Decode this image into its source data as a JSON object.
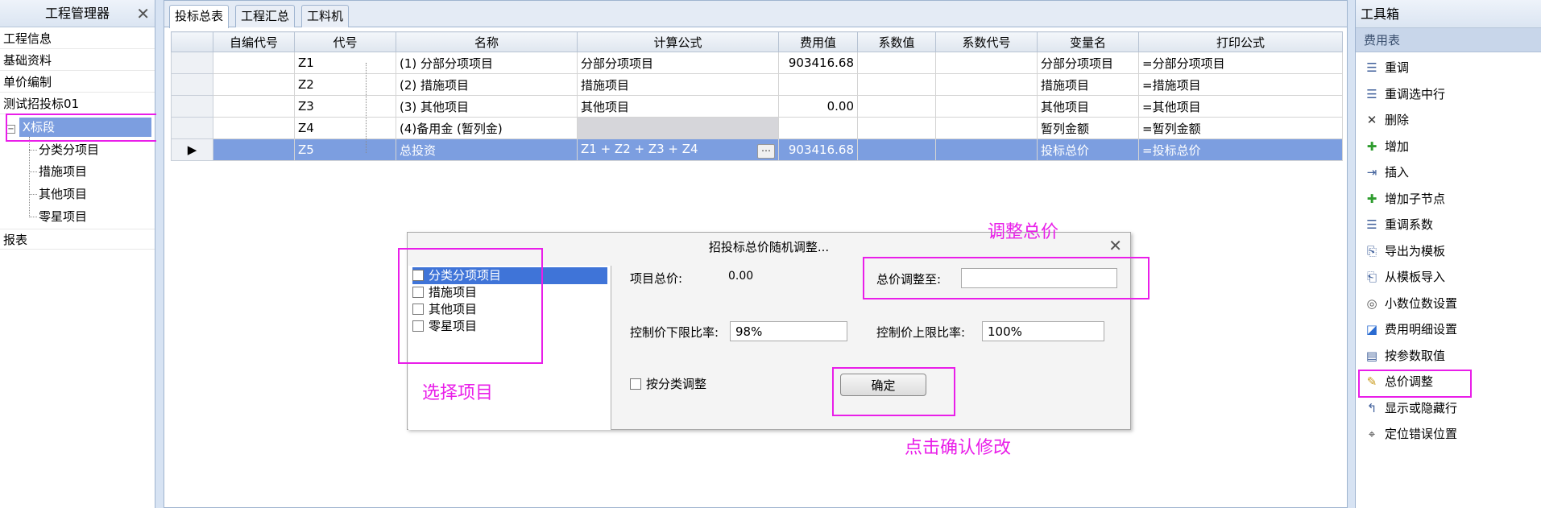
{
  "left_panel": {
    "title": "工程管理器",
    "items": [
      "工程信息",
      "基础资料",
      "单价编制",
      "测试招投标01"
    ],
    "section_node": "X标段",
    "children": [
      "分类分项目",
      "措施项目",
      "其他项目",
      "零星项目"
    ],
    "footer_item": "报表"
  },
  "tabs": [
    "投标总表",
    "工程汇总",
    "工料机"
  ],
  "grid": {
    "columns": [
      "自编代号",
      "代号",
      "名称",
      "计算公式",
      "费用值",
      "系数值",
      "系数代号",
      "变量名",
      "打印公式"
    ],
    "rows": [
      {
        "code": "Z1",
        "name": "(1) 分部分项项目",
        "formula": "分部分项项目",
        "value": "903416.68",
        "var": "分部分项项目",
        "print": "=分部分项项目"
      },
      {
        "code": "Z2",
        "name": "(2) 措施项目",
        "formula": "措施项目",
        "value": "",
        "var": "措施项目",
        "print": "=措施项目"
      },
      {
        "code": "Z3",
        "name": "(3) 其他项目",
        "formula": "其他项目",
        "value": "0.00",
        "var": "其他项目",
        "print": "=其他项目"
      },
      {
        "code": "Z4",
        "name": "(4)备用金 (暂列金)",
        "formula": "",
        "value": "",
        "var": "暂列金额",
        "print": "=暂列金额"
      },
      {
        "code": "Z5",
        "name": "总投资",
        "formula": "Z1 + Z2 + Z3 + Z4",
        "value": "903416.68",
        "var": "投标总价",
        "print": "=投标总价"
      }
    ]
  },
  "dialog": {
    "title": "招投标总价随机调整...",
    "list": [
      "分类分项项目",
      "措施项目",
      "其他项目",
      "零星项目"
    ],
    "project_total_label": "项目总价:",
    "project_total_value": "0.00",
    "adjust_to_label": "总价调整至:",
    "adjust_to_value": "",
    "lower_label": "控制价下限比率:",
    "lower_value": "98%",
    "upper_label": "控制价上限比率:",
    "upper_value": "100%",
    "by_category_label": "按分类调整",
    "ok_label": "确定"
  },
  "annotations": {
    "adjust_total": "调整总价",
    "select_items": "选择项目",
    "click_confirm": "点击确认修改",
    "color": "#e91ee9"
  },
  "toolbox": {
    "title": "工具箱",
    "section": "费用表",
    "tools": [
      {
        "label": "重调",
        "icon": "list-icon"
      },
      {
        "label": "重调选中行",
        "icon": "list-icon"
      },
      {
        "label": "删除",
        "icon": "close-icon"
      },
      {
        "label": "增加",
        "icon": "plus-icon"
      },
      {
        "label": "插入",
        "icon": "insert-icon"
      },
      {
        "label": "增加子节点",
        "icon": "plus-icon"
      },
      {
        "label": "重调系数",
        "icon": "list-icon"
      },
      {
        "label": "导出为模板",
        "icon": "export-icon"
      },
      {
        "label": "从模板导入",
        "icon": "import-icon"
      },
      {
        "label": "小数位数设置",
        "icon": "settings-icon"
      },
      {
        "label": "费用明细设置",
        "icon": "chart-icon"
      },
      {
        "label": "按参数取值",
        "icon": "param-icon"
      },
      {
        "label": "总价调整",
        "icon": "pencil-icon"
      },
      {
        "label": "显示或隐藏行",
        "icon": "toggle-icon"
      },
      {
        "label": "定位错误位置",
        "icon": "locate-icon"
      }
    ]
  }
}
